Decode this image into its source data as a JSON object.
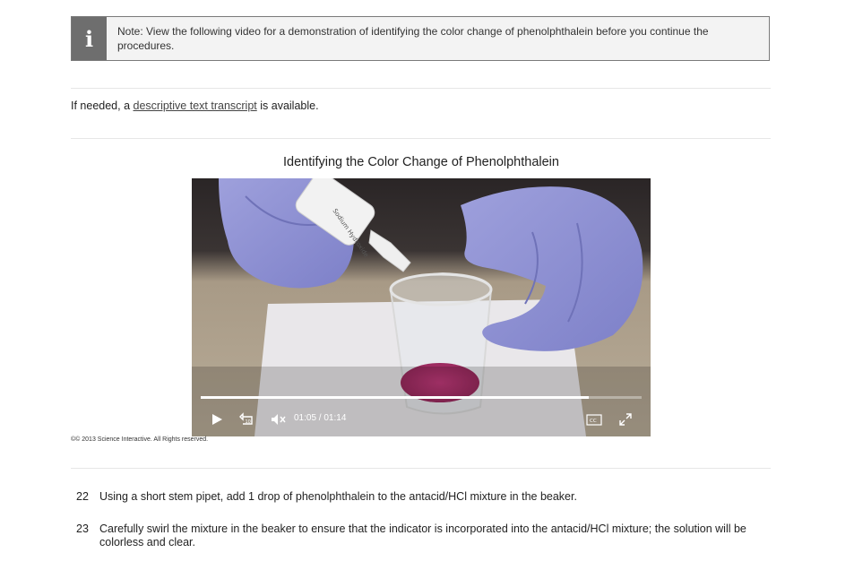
{
  "note": {
    "icon": "info-icon",
    "icon_glyph": "i",
    "text": "Note: View the following video for a demonstration of identifying the color change of phenolphthalein before you continue the procedures."
  },
  "transcript": {
    "prefix": "If needed, a ",
    "link": "descriptive text transcript",
    "suffix": " is available."
  },
  "video": {
    "title": "Identifying the Color Change of Phenolphthalein",
    "bottle_label": "Sodium Hydroxide",
    "current_time": "01:05",
    "duration": "01:14",
    "time_text": "01:05 / 01:14",
    "progress": 0.88,
    "controls": {
      "play": "play-icon",
      "rewind": "rewind-10-icon",
      "rewind_label": "10",
      "mute": "muted-speaker-icon",
      "captions": "closed-captions-icon",
      "captions_label": "CC",
      "fullscreen": "fullscreen-icon"
    }
  },
  "copyright": "©© 2013 Science Interactive. All Rights reserved.",
  "steps": [
    {
      "number": "22",
      "text": "Using a short stem pipet, add 1 drop of phenolphthalein to the antacid/HCl mixture in the beaker."
    },
    {
      "number": "23",
      "text": "Carefully swirl the mixture in the beaker to ensure that the indicator is incorporated into the antacid/HCl mixture; the solution will be colorless and clear."
    }
  ]
}
